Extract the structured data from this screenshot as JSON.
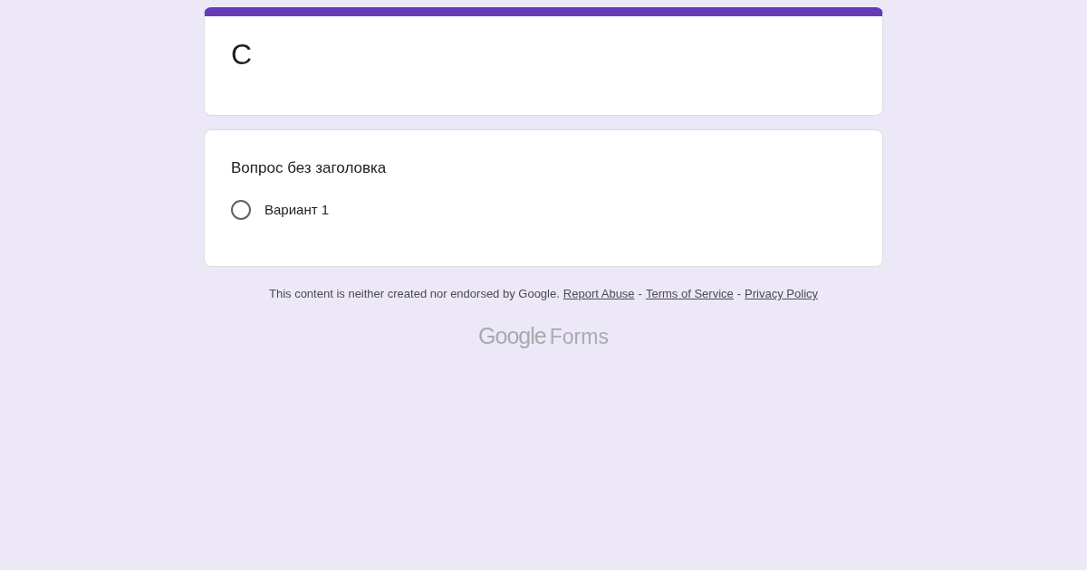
{
  "form": {
    "title": "С"
  },
  "questions": [
    {
      "title": "Вопрос без заголовка",
      "options": [
        {
          "label": "Вариант 1",
          "selected": false
        }
      ]
    }
  ],
  "footer": {
    "notice": "This content is neither created nor endorsed by Google.",
    "links": [
      "Report Abuse",
      "Terms of Service",
      "Privacy Policy"
    ],
    "separator": "-"
  },
  "logo": {
    "brand": "Google",
    "product": "Forms"
  }
}
